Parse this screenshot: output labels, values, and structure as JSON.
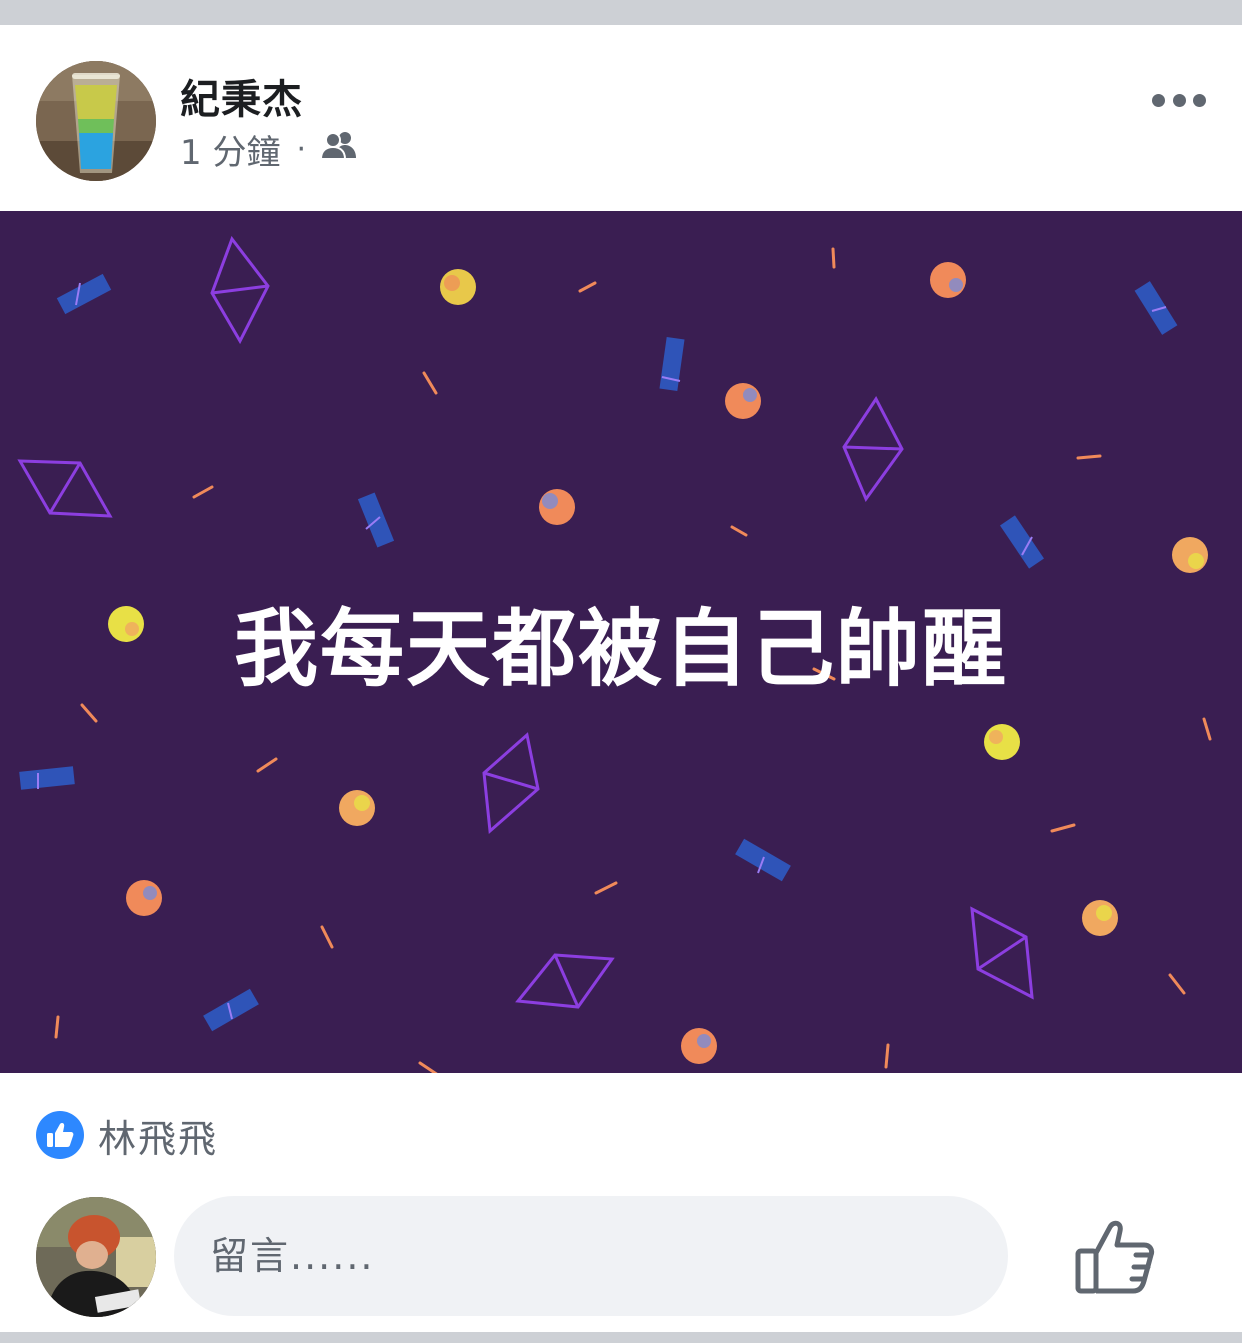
{
  "post": {
    "author": "紀秉杰",
    "time": "1 分鐘",
    "separator": "·",
    "privacy_icon": "friends-icon",
    "menu_icon": "more-horizontal-icon",
    "text": "我每天都被自己帥醒",
    "background_color": "#3a1e52"
  },
  "reactions": {
    "icon": "like-icon",
    "names": "林飛飛"
  },
  "comment": {
    "placeholder": "留言......",
    "like_icon": "thumbs-up-outline-icon"
  },
  "colors": {
    "like_blue": "#2d88ff",
    "secondary_text": "#606770",
    "primary_text": "#1c1e21"
  }
}
